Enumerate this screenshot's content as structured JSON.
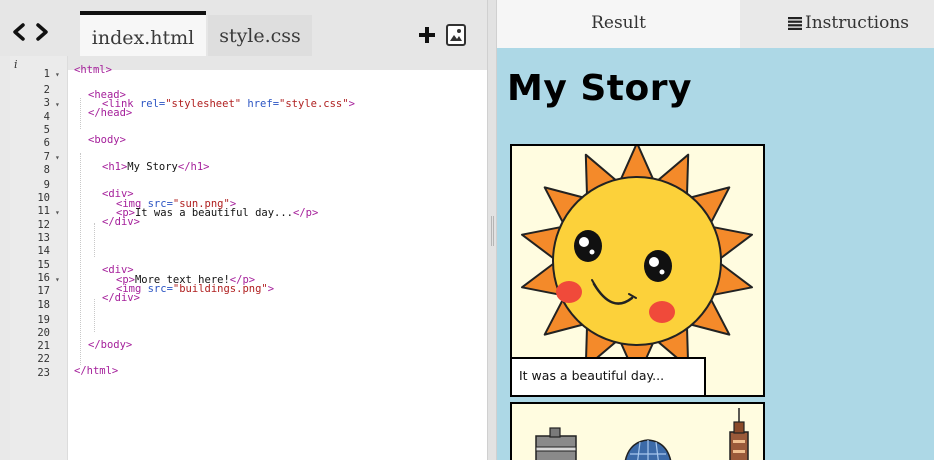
{
  "editor": {
    "tabs": [
      {
        "label": "index.html",
        "active": true
      },
      {
        "label": "style.css",
        "active": false
      }
    ],
    "icons": {
      "nav": "code-brackets-icon",
      "add": "plus-icon",
      "save": "image-save-icon",
      "info": "info-icon"
    },
    "line_numbers": [
      "1",
      "2",
      "3",
      "4",
      "5",
      "6",
      "7",
      "8",
      "9",
      "10",
      "11",
      "12",
      "13",
      "14",
      "15",
      "16",
      "17",
      "18",
      "19",
      "20",
      "21",
      "22",
      "23"
    ],
    "folded_lines": [
      "1",
      "3",
      "7",
      "11",
      "16"
    ],
    "code": {
      "l1_tag": "<html>",
      "l3_tag": "<head>",
      "l4_a": "<link ",
      "l4_b": "rel=",
      "l4_c": "\"stylesheet\"",
      "l4_d": " href=",
      "l4_e": "\"style.css\"",
      "l4_f": ">",
      "l5_tag": "</head>",
      "l7_tag": "<body>",
      "l9_a": "<h1>",
      "l9_b": "My Story",
      "l9_c": "</h1>",
      "l11_tag": "<div>",
      "l12_a": "<img ",
      "l12_b": "src=",
      "l12_c": "\"sun.png\"",
      "l12_d": ">",
      "l13_a": "<p>",
      "l13_b": "It was a beautiful day...",
      "l13_c": "</p>",
      "l14_tag": "</div>",
      "l16_tag": "<div>",
      "l17_a": "<p>",
      "l17_b": "More text here!",
      "l17_c": "</p>",
      "l18_a": "<img ",
      "l18_b": "src=",
      "l18_c": "\"buildings.png\"",
      "l18_d": ">",
      "l19_tag": "</div>",
      "l21_tag": "</body>",
      "l23_tag": "</html>"
    }
  },
  "result": {
    "tabs": {
      "result": "Result",
      "instructions": "Instructions"
    },
    "page_title": "My Story",
    "caption_1": "It was a beautiful day...",
    "background_color": "#add8e6"
  },
  "colors": {
    "tag": "#a5209b",
    "attribute": "#2b54c3",
    "string": "#b02020",
    "sun": "#fcd13a",
    "sun_rays": "#f48a2a"
  }
}
